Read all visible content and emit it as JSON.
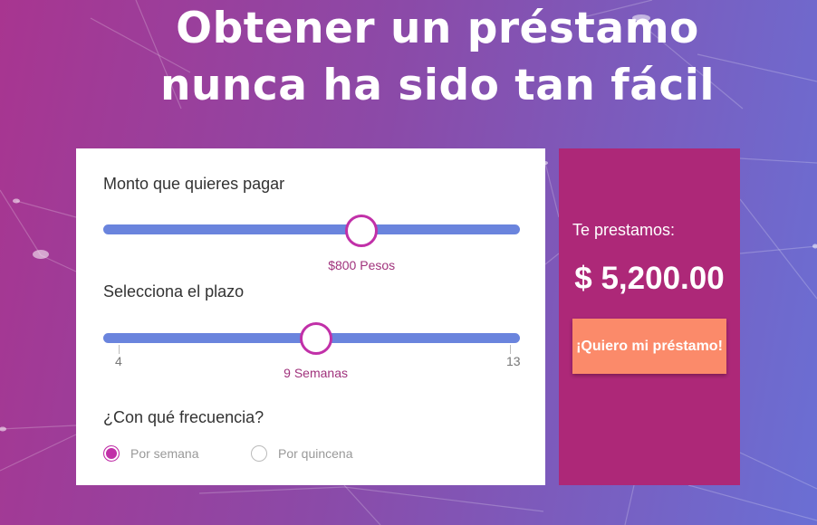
{
  "hero": {
    "line1": "Obtener un préstamo",
    "line2": "nunca ha sido tan fácil"
  },
  "calculator": {
    "amount": {
      "label": "Monto que quieres pagar",
      "value_label": "$800 Pesos",
      "position": 0.62
    },
    "term": {
      "label": "Selecciona el plazo",
      "min_label": "4",
      "max_label": "13",
      "value_label": "9 Semanas",
      "position": 0.51
    },
    "frequency": {
      "label": "¿Con qué frecuencia?",
      "options": [
        {
          "label": "Por semana",
          "selected": true
        },
        {
          "label": "Por quincena",
          "selected": false
        }
      ]
    }
  },
  "summary": {
    "label": "Te prestamos:",
    "amount": "$ 5,200.00",
    "cta_label": "¡Quiero mi préstamo!"
  },
  "colors": {
    "accent": "#c130a8",
    "track": "#6a84dd",
    "summary_bg": "#ad2878",
    "cta_bg": "#fb8a6a"
  }
}
